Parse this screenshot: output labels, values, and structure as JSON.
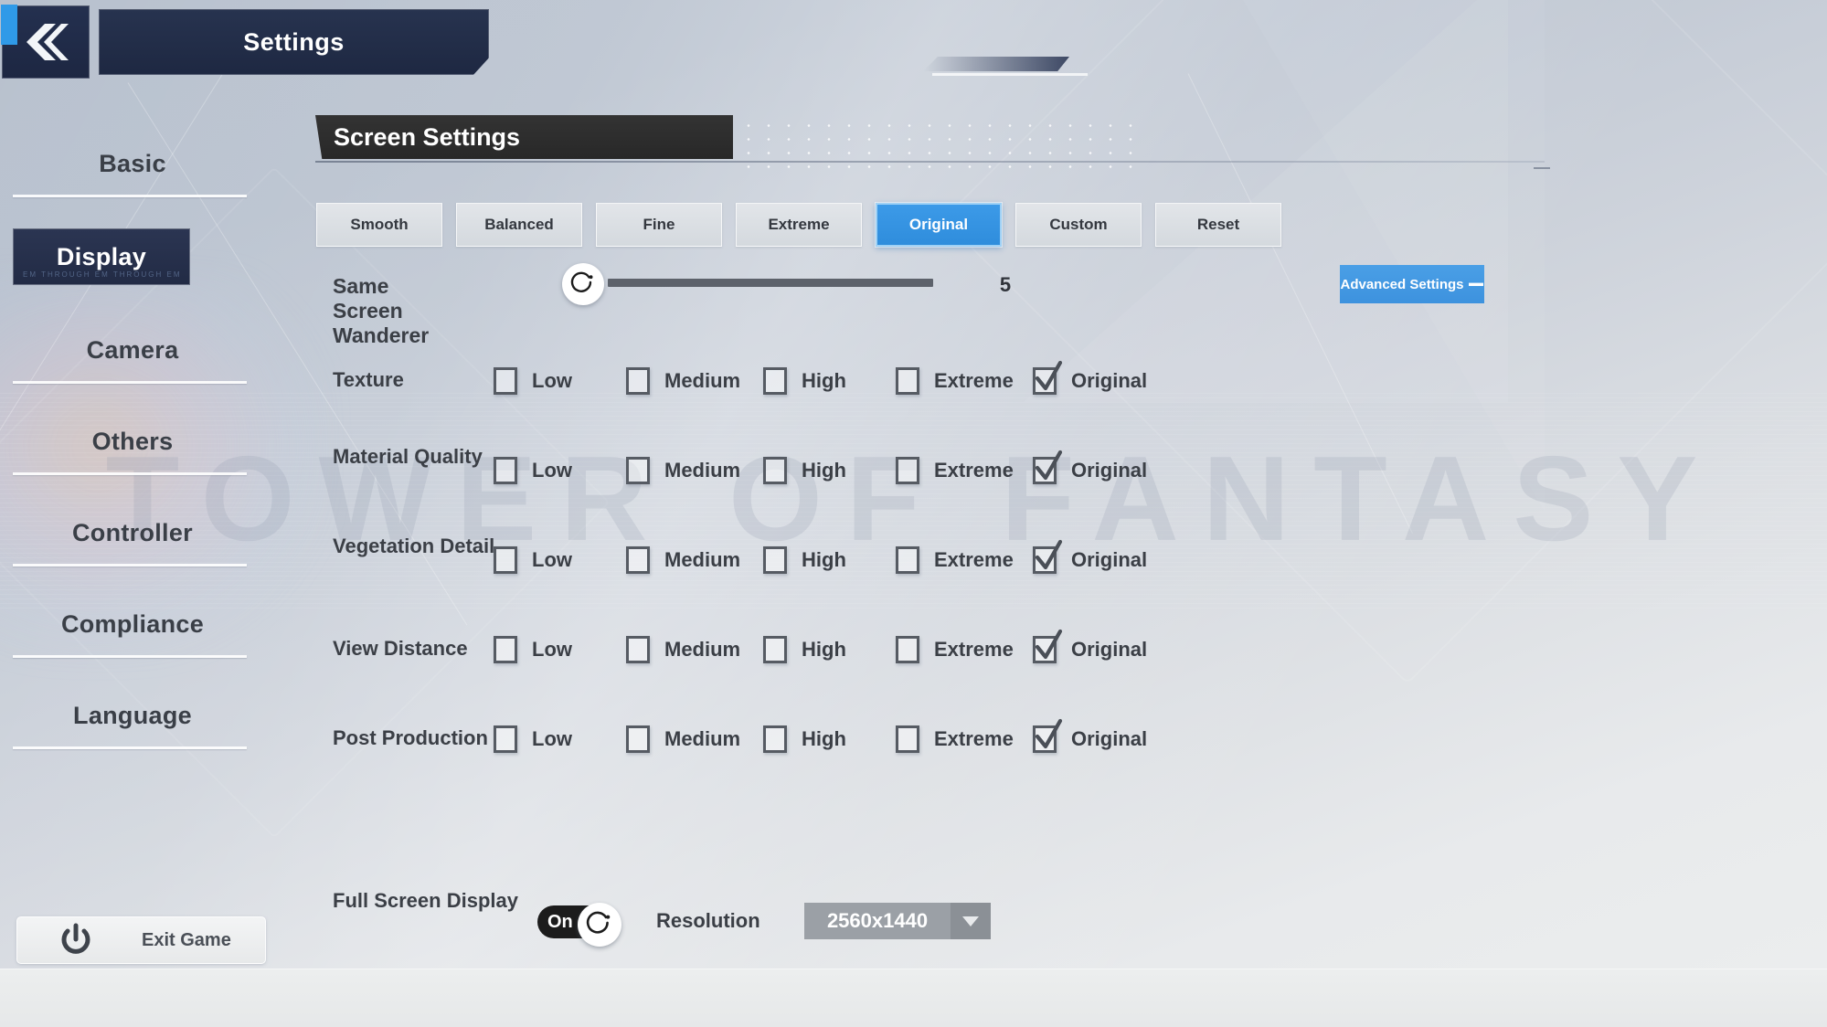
{
  "window": {
    "title": "Settings",
    "back_icon": "double-chevron-left-icon",
    "watermark": "TOWER OF FANTASY"
  },
  "sidebar": {
    "items": [
      {
        "label": "Basic",
        "active": false
      },
      {
        "label": "Display",
        "active": true
      },
      {
        "label": "Camera",
        "active": false
      },
      {
        "label": "Others",
        "active": false
      },
      {
        "label": "Controller",
        "active": false
      },
      {
        "label": "Compliance",
        "active": false
      },
      {
        "label": "Language",
        "active": false
      }
    ],
    "active_ghost_text": "EM THROUGH EM THROUGH EM THROUGH",
    "exit": {
      "label": "Exit Game",
      "icon": "power-icon"
    }
  },
  "main": {
    "section_title": "Screen Settings",
    "presets": [
      {
        "label": "Smooth",
        "selected": false
      },
      {
        "label": "Balanced",
        "selected": false
      },
      {
        "label": "Fine",
        "selected": false
      },
      {
        "label": "Extreme",
        "selected": false
      },
      {
        "label": "Original",
        "selected": true
      },
      {
        "label": "Custom",
        "selected": false
      },
      {
        "label": "Reset",
        "selected": false
      }
    ],
    "slider": {
      "label": "Same Screen Wanderer",
      "value": "5",
      "fill_percent": 0,
      "knob_icon": "circular-dial-icon"
    },
    "advanced_button": {
      "label": "Advanced Settings",
      "suffix_icon": "minus-icon"
    },
    "quality_rows": [
      {
        "label": "Texture",
        "two_line": false,
        "options": [
          {
            "label": "Low",
            "checked": false
          },
          {
            "label": "Medium",
            "checked": false
          },
          {
            "label": "High",
            "checked": false
          },
          {
            "label": "Extreme",
            "checked": false
          },
          {
            "label": "Original",
            "checked": true
          }
        ]
      },
      {
        "label": "Material Quality",
        "two_line": true,
        "options": [
          {
            "label": "Low",
            "checked": false
          },
          {
            "label": "Medium",
            "checked": false
          },
          {
            "label": "High",
            "checked": false
          },
          {
            "label": "Extreme",
            "checked": false
          },
          {
            "label": "Original",
            "checked": true
          }
        ]
      },
      {
        "label": "Vegetation Detail",
        "two_line": true,
        "options": [
          {
            "label": "Low",
            "checked": false
          },
          {
            "label": "Medium",
            "checked": false
          },
          {
            "label": "High",
            "checked": false
          },
          {
            "label": "Extreme",
            "checked": false
          },
          {
            "label": "Original",
            "checked": true
          }
        ]
      },
      {
        "label": "View Distance",
        "two_line": false,
        "options": [
          {
            "label": "Low",
            "checked": false
          },
          {
            "label": "Medium",
            "checked": false
          },
          {
            "label": "High",
            "checked": false
          },
          {
            "label": "Extreme",
            "checked": false
          },
          {
            "label": "Original",
            "checked": true
          }
        ]
      },
      {
        "label": "Post Production",
        "two_line": false,
        "options": [
          {
            "label": "Low",
            "checked": false
          },
          {
            "label": "Medium",
            "checked": false
          },
          {
            "label": "High",
            "checked": false
          },
          {
            "label": "Extreme",
            "checked": false
          },
          {
            "label": "Original",
            "checked": true
          }
        ]
      }
    ],
    "fullscreen_row": {
      "label": "Full Screen Display",
      "toggle_state": "On",
      "toggle_knob_icon": "circular-dial-icon",
      "resolution_label": "Resolution",
      "resolution_value": "2560x1440",
      "resolution_arrow_icon": "chevron-down-icon"
    }
  },
  "colors": {
    "accent_blue": "#3c9ae8",
    "panel_dark": "#27334f",
    "section_dark": "#2e2e2e",
    "text_dark": "#3b3f46"
  }
}
